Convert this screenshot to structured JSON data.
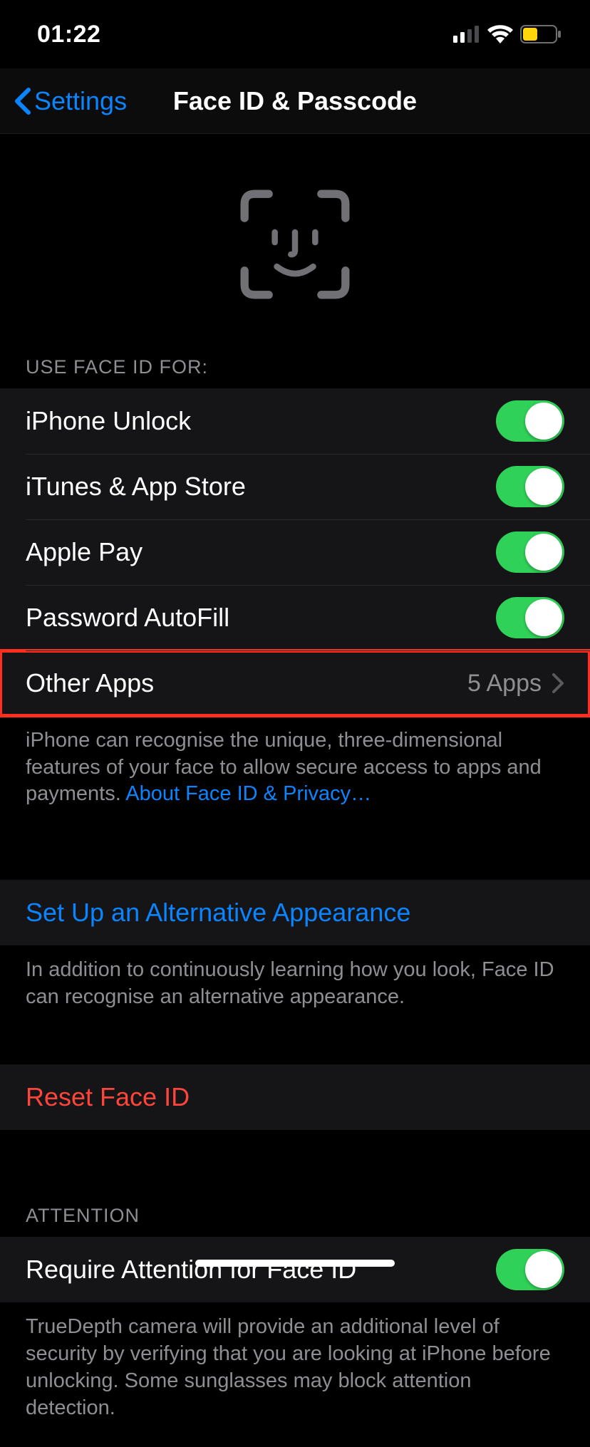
{
  "status": {
    "time": "01:22"
  },
  "nav": {
    "back_label": "Settings",
    "title": "Face ID & Passcode"
  },
  "sections": {
    "use_header": "USE FACE ID FOR:",
    "items": {
      "iphone_unlock": "iPhone Unlock",
      "itunes": "iTunes & App Store",
      "apple_pay": "Apple Pay",
      "autofill": "Password AutoFill",
      "other_apps": "Other Apps",
      "other_apps_detail": "5 Apps"
    },
    "use_footer_text": "iPhone can recognise the unique, three-dimensional features of your face to allow secure access to apps and payments. ",
    "use_footer_link": "About Face ID & Privacy…",
    "alt_appearance": "Set Up an Alternative Appearance",
    "alt_footer": "In addition to continuously learning how you look, Face ID can recognise an alternative appearance.",
    "reset": "Reset Face ID",
    "attention_header": "ATTENTION",
    "require_attention": "Require Attention for Face ID",
    "attention_footer": "TrueDepth camera will provide an additional level of security by verifying that you are looking at iPhone before unlocking. Some sunglasses may block attention detection."
  },
  "toggles": {
    "iphone_unlock": true,
    "itunes": true,
    "apple_pay": true,
    "autofill": true,
    "require_attention": true
  }
}
